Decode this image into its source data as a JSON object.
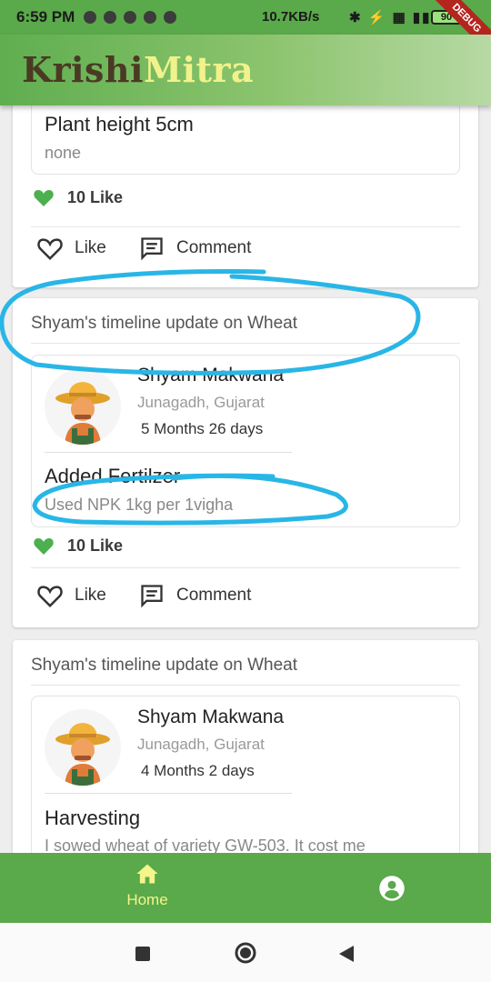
{
  "status_bar": {
    "time": "6:59 PM",
    "network_speed": "10.7KB/s",
    "icons": "✱ ⚡ ▦ ▮▮▮ ≋",
    "battery": "90",
    "debug_label": "DEBUG"
  },
  "app": {
    "title_part1": "Krishi",
    "title_part2": "Mitra",
    "title_colors": [
      "#4a3a24",
      "#f1f28c"
    ],
    "accent_color": "#5aa94a"
  },
  "feed": {
    "posts": [
      {
        "entry_title": "Plant height 5cm",
        "entry_desc": "none",
        "likes": "10 Like",
        "like_label": "Like",
        "comment_label": "Comment"
      },
      {
        "header": "Shyam's timeline update on Wheat",
        "user_name": "Shyam Makwana",
        "user_location": "Junagadh, Gujarat",
        "user_age": "5 Months  26 days",
        "entry_title": "Added Fertilzer",
        "entry_desc": "Used NPK 1kg per 1vigha",
        "likes": "10 Like",
        "like_label": "Like",
        "comment_label": "Comment"
      },
      {
        "header": "Shyam's timeline update on Wheat",
        "user_name": "Shyam Makwana",
        "user_location": "Junagadh, Gujarat",
        "user_age": "4 Months  2 days",
        "entry_title": "Harvesting",
        "entry_desc": "I sowed wheat of variety GW-503. It cost me"
      }
    ]
  },
  "bottom_nav": {
    "home_label": "Home",
    "home_icon": "home-icon",
    "profile_icon": "account-circle-icon"
  },
  "annotation_color": "#29b6e6"
}
